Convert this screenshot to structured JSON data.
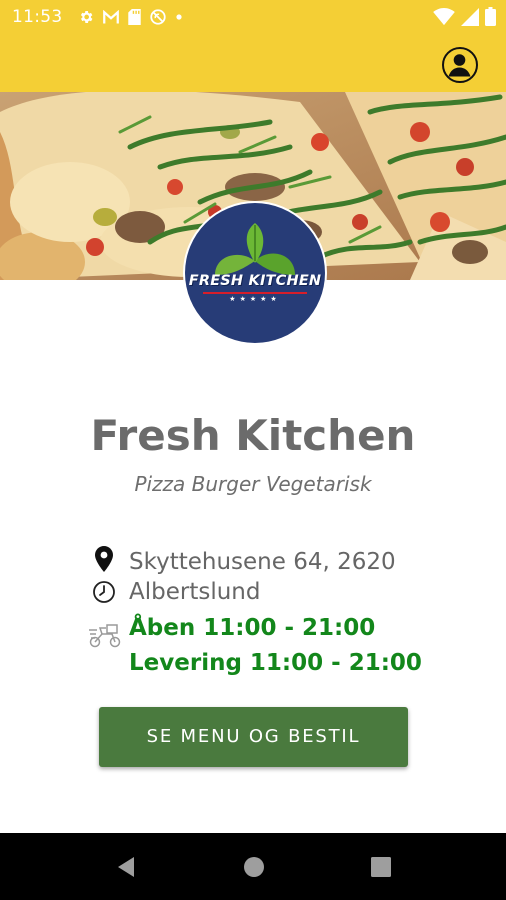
{
  "status_bar": {
    "time": "11:53",
    "left_icons": [
      "settings-icon",
      "gmail-icon",
      "sd-card-icon",
      "no-disturb-icon",
      "dot-icon"
    ],
    "right_icons": [
      "wifi-icon",
      "signal-icon",
      "battery-icon"
    ]
  },
  "app_bar": {
    "background": "#f4cf35",
    "account_icon": "account-circle-icon"
  },
  "logo": {
    "text": "FRESH KITCHEN",
    "stars": "★★★★★"
  },
  "restaurant": {
    "name": "Fresh Kitchen",
    "tagline": "Pizza Burger Vegetarisk",
    "address_line1": "Skyttehusene 64, 2620",
    "address_line2": "Albertslund",
    "open_hours": "Åben 11:00 - 21:00",
    "delivery_hours": "Levering 11:00 - 21:00"
  },
  "actions": {
    "menu_button_label": "SE MENU OG BESTIL"
  },
  "colors": {
    "accent_yellow": "#f4cf35",
    "button_green": "#4a7a3e",
    "hours_green": "#13871b",
    "logo_navy": "#273c77"
  },
  "nav_bar": {
    "buttons": [
      "back-icon",
      "home-icon",
      "recents-icon"
    ]
  }
}
